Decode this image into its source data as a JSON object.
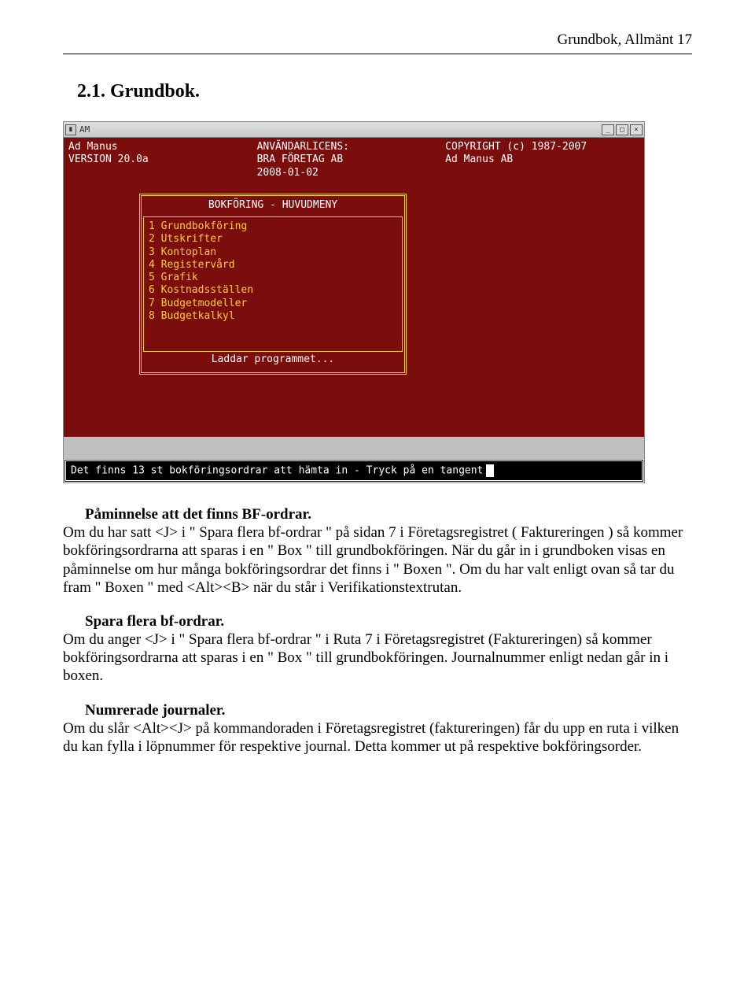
{
  "header": {
    "running_head": "Grundbok, Allmänt  17"
  },
  "section_title": "2.1. Grundbok.",
  "terminal": {
    "window_title": "AM",
    "info": {
      "col1_line1": "Ad Manus",
      "col1_line2": "VERSION 20.0a",
      "col2_line1": "ANVÄNDARLICENS:",
      "col2_line2": "BRA FÖRETAG AB",
      "col2_line3": "2008-01-02",
      "col3_line1": "COPYRIGHT (c) 1987-2007",
      "col3_line2": "Ad Manus AB"
    },
    "menu_title": "BOKFÖRING - HUVUDMENY",
    "menu_items": [
      "1 Grundbokföring",
      "2 Utskrifter",
      "3 Kontoplan",
      "4 Registervård",
      "5 Grafik",
      "6 Kostnadsställen",
      "7 Budgetmodeller",
      "8 Budgetkalkyl"
    ],
    "loading": "Laddar programmet...",
    "bottom_message": "Det finns 13 st bokföringsordrar att hämta in - Tryck på en tangent"
  },
  "paragraphs": {
    "p1_head": "Påminnelse att det finns BF-ordrar.",
    "p1_body": "Om du har satt <J> i \" Spara flera bf-ordrar \" på sidan 7 i Företagsregistret ( Faktureringen ) så kommer bokföringsordrarna att sparas i en \" Box \" till grundbokföringen. När du går in i grundboken visas en påminnelse om hur många bokföringsordrar det finns i \" Boxen \". Om du har valt enligt ovan så tar du fram \" Boxen \" med <Alt><B> när du står i Verifikationstextrutan.",
    "p2_head": "Spara flera bf-ordrar.",
    "p2_body": "Om du anger <J> i \" Spara flera bf-ordrar \" i Ruta 7 i Företagsregistret (Faktureringen) så kommer bokföringsordrarna att sparas i en \" Box \" till grundbokföringen. Journalnummer enligt nedan går in i boxen.",
    "p3_head": "Numrerade journaler.",
    "p3_body": "Om du slår <Alt><J> på kommandoraden i Företagsregistret (faktureringen) får du upp en ruta i vilken du kan fylla i löpnummer för respektive journal. Detta kommer ut på respektive bokföringsorder."
  }
}
